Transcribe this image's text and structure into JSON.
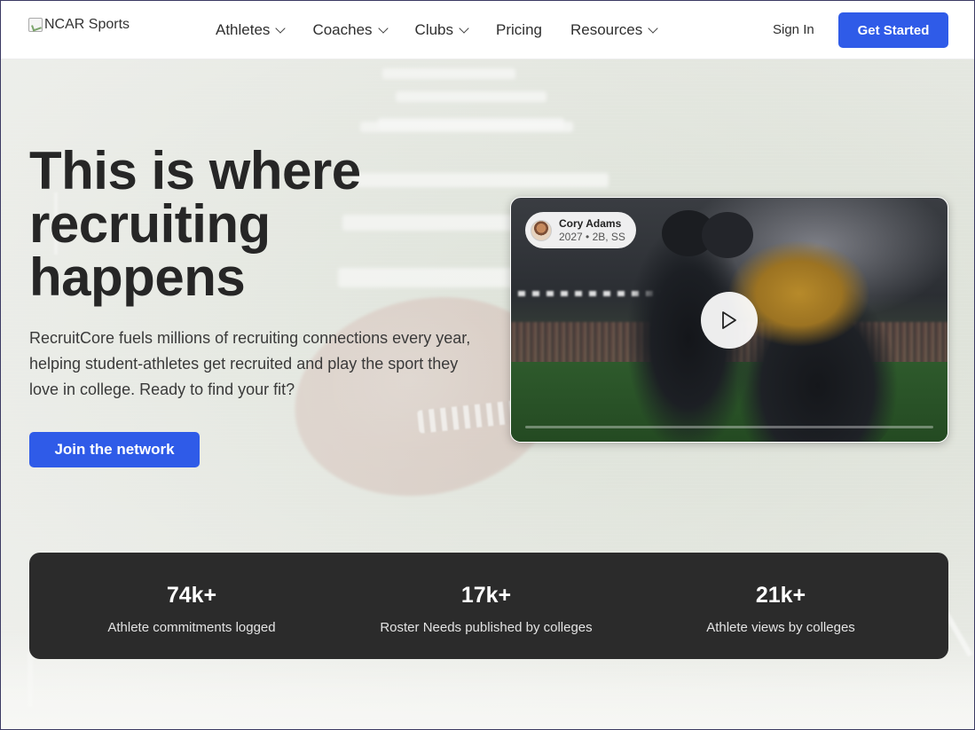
{
  "header": {
    "logo_text": "NCAR Sports",
    "nav": [
      {
        "label": "Athletes",
        "has_dropdown": true
      },
      {
        "label": "Coaches",
        "has_dropdown": true
      },
      {
        "label": "Clubs",
        "has_dropdown": true
      },
      {
        "label": "Pricing",
        "has_dropdown": false
      },
      {
        "label": "Resources",
        "has_dropdown": true
      }
    ],
    "sign_in": "Sign In",
    "get_started": "Get Started"
  },
  "hero": {
    "title_line1": "This is where",
    "title_line2": "recruiting",
    "title_line3": "happens",
    "description": "RecruitCore fuels millions of recruiting connections every year, helping student-athletes get recruited and play the sport they love in college. Ready to find your fit?",
    "cta": "Join the network"
  },
  "video": {
    "athlete_name": "Cory Adams",
    "athlete_meta": "2027 • 2B, SS",
    "play_icon": "play-icon",
    "progress": 0
  },
  "stats": [
    {
      "value": "74k+",
      "label": "Athlete commitments logged"
    },
    {
      "value": "17k+",
      "label": "Roster Needs published by colleges"
    },
    {
      "value": "21k+",
      "label": "Athlete views by colleges"
    }
  ],
  "colors": {
    "accent": "#2f5be8",
    "stats_bg": "#2b2b2b",
    "title": "#262626"
  }
}
